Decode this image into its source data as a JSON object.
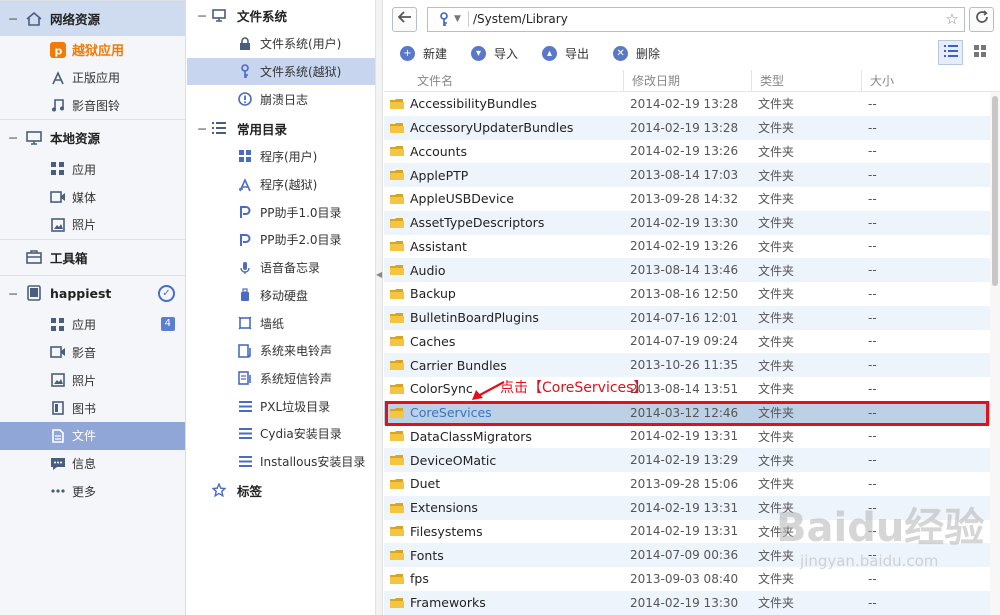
{
  "sidebar": {
    "sections": [
      {
        "title": "网络资源",
        "active": true,
        "items": [
          {
            "label": "越狱应用",
            "icon": "pp-icon",
            "highlight": true
          },
          {
            "label": "正版应用",
            "icon": "app-store-icon"
          },
          {
            "label": "影音图铃",
            "icon": "music-note-icon"
          }
        ]
      },
      {
        "title": "本地资源",
        "items": [
          {
            "label": "应用",
            "icon": "grid-icon"
          },
          {
            "label": "媒体",
            "icon": "video-icon"
          },
          {
            "label": "照片",
            "icon": "photo-icon"
          }
        ]
      },
      {
        "title": "工具箱",
        "items": []
      },
      {
        "title": "happiest",
        "items": [
          {
            "label": "应用",
            "icon": "grid-icon",
            "badge": "4"
          },
          {
            "label": "影音",
            "icon": "video-icon"
          },
          {
            "label": "照片",
            "icon": "photo-icon"
          },
          {
            "label": "图书",
            "icon": "book-icon"
          },
          {
            "label": "文件",
            "icon": "file-icon",
            "selected": true
          },
          {
            "label": "信息",
            "icon": "chat-icon"
          },
          {
            "label": "更多",
            "icon": "more-icon"
          }
        ]
      }
    ]
  },
  "tree": {
    "groups": [
      {
        "title": "文件系统",
        "items": [
          {
            "label": "文件系统(用户)",
            "icon": "lock-icon"
          },
          {
            "label": "文件系统(越狱)",
            "icon": "key-icon",
            "selected": true
          },
          {
            "label": "崩溃日志",
            "icon": "alert-icon"
          }
        ]
      },
      {
        "title": "常用目录",
        "items": [
          {
            "label": "程序(用户)",
            "icon": "grid-icon"
          },
          {
            "label": "程序(越狱)",
            "icon": "appstore-a-icon"
          },
          {
            "label": "PP助手1.0目录",
            "icon": "pp-icon"
          },
          {
            "label": "PP助手2.0目录",
            "icon": "pp-icon"
          },
          {
            "label": "语音备忘录",
            "icon": "microphone-icon"
          },
          {
            "label": "移动硬盘",
            "icon": "usb-drive-icon"
          },
          {
            "label": "墙纸",
            "icon": "wallpaper-icon"
          },
          {
            "label": "系统来电铃声",
            "icon": "ringtone-icon"
          },
          {
            "label": "系统短信铃声",
            "icon": "sms-tone-icon"
          },
          {
            "label": "PXL垃圾目录",
            "icon": "list-icon"
          },
          {
            "label": "Cydia安装目录",
            "icon": "list-icon"
          },
          {
            "label": "Installous安装目录",
            "icon": "list-icon"
          }
        ]
      },
      {
        "title": "标签",
        "items": []
      }
    ]
  },
  "address": {
    "path": "/System/Library"
  },
  "toolbar": {
    "new_label": "新建",
    "import_label": "导入",
    "export_label": "导出",
    "delete_label": "删除"
  },
  "columns": {
    "name": "文件名",
    "date": "修改日期",
    "type": "类型",
    "size": "大小"
  },
  "files": [
    {
      "name": "AccessibilityBundles",
      "date": "2014-02-19 13:28",
      "type": "文件夹",
      "size": "--"
    },
    {
      "name": "AccessoryUpdaterBundles",
      "date": "2014-02-19 13:28",
      "type": "文件夹",
      "size": "--"
    },
    {
      "name": "Accounts",
      "date": "2014-02-19 13:26",
      "type": "文件夹",
      "size": "--"
    },
    {
      "name": "ApplePTP",
      "date": "2013-08-14 17:03",
      "type": "文件夹",
      "size": "--"
    },
    {
      "name": "AppleUSBDevice",
      "date": "2013-09-28 14:32",
      "type": "文件夹",
      "size": "--"
    },
    {
      "name": "AssetTypeDescriptors",
      "date": "2014-02-19 13:30",
      "type": "文件夹",
      "size": "--"
    },
    {
      "name": "Assistant",
      "date": "2014-02-19 13:26",
      "type": "文件夹",
      "size": "--"
    },
    {
      "name": "Audio",
      "date": "2013-08-14 13:46",
      "type": "文件夹",
      "size": "--"
    },
    {
      "name": "Backup",
      "date": "2013-08-16 12:50",
      "type": "文件夹",
      "size": "--"
    },
    {
      "name": "BulletinBoardPlugins",
      "date": "2014-07-16 12:01",
      "type": "文件夹",
      "size": "--"
    },
    {
      "name": "Caches",
      "date": "2014-07-19 09:24",
      "type": "文件夹",
      "size": "--"
    },
    {
      "name": "Carrier Bundles",
      "date": "2013-10-26 11:35",
      "type": "文件夹",
      "size": "--"
    },
    {
      "name": "ColorSync",
      "date": "2013-08-14 13:51",
      "type": "文件夹",
      "size": "--"
    },
    {
      "name": "CoreServices",
      "date": "2014-03-12 12:46",
      "type": "文件夹",
      "size": "--",
      "selected": true
    },
    {
      "name": "DataClassMigrators",
      "date": "2014-02-19 13:31",
      "type": "文件夹",
      "size": "--"
    },
    {
      "name": "DeviceOMatic",
      "date": "2014-02-19 13:29",
      "type": "文件夹",
      "size": "--"
    },
    {
      "name": "Duet",
      "date": "2013-09-28 15:06",
      "type": "文件夹",
      "size": "--"
    },
    {
      "name": "Extensions",
      "date": "2014-02-19 13:31",
      "type": "文件夹",
      "size": "--"
    },
    {
      "name": "Filesystems",
      "date": "2014-02-19 13:31",
      "type": "文件夹",
      "size": "--"
    },
    {
      "name": "Fonts",
      "date": "2014-07-09 00:36",
      "type": "文件夹",
      "size": "--"
    },
    {
      "name": "fps",
      "date": "2013-09-03 08:40",
      "type": "文件夹",
      "size": "--"
    },
    {
      "name": "Frameworks",
      "date": "2014-02-19 13:30",
      "type": "文件夹",
      "size": "--"
    }
  ],
  "annotation": {
    "text": "点击【CoreServices】",
    "color": "#e2101b"
  },
  "watermark": {
    "brand": "Baidu经验",
    "url": "jingyan.baidu.com"
  },
  "colors": {
    "accent": "#5a78c8",
    "highlight": "#f07a0a",
    "selected_sidebar": "#8fa6d6",
    "selected_row": "#bcd1e6",
    "annotation_red": "#e2101b"
  }
}
